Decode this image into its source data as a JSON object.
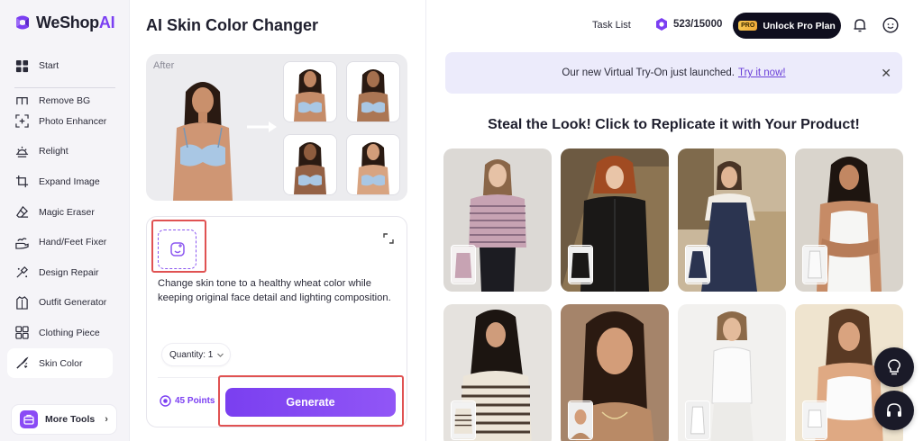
{
  "brand": {
    "name_main": "WeShop",
    "name_ai": "AI"
  },
  "sidebar": {
    "items": [
      {
        "label": "Start",
        "icon": "grid-icon"
      },
      {
        "label": "Remove BG",
        "icon": "scissors-icon"
      },
      {
        "label": "Photo Enhancer",
        "icon": "enhance-icon"
      },
      {
        "label": "Relight",
        "icon": "sun-icon"
      },
      {
        "label": "Expand Image",
        "icon": "crop-icon"
      },
      {
        "label": "Magic Eraser",
        "icon": "eraser-icon"
      },
      {
        "label": "Hand/Feet Fixer",
        "icon": "hand-icon"
      },
      {
        "label": "Design Repair",
        "icon": "repair-icon"
      },
      {
        "label": "Outfit Generator",
        "icon": "outfit-icon"
      },
      {
        "label": "Clothing Piece",
        "icon": "clothing-icon"
      },
      {
        "label": "Skin Color",
        "icon": "skin-icon"
      }
    ],
    "active": "Skin Color",
    "more_tools": "More Tools"
  },
  "tool": {
    "title": "AI Skin Color Changer",
    "preview_label": "After",
    "prompt": "Change skin tone to a healthy wheat color while keeping original face detail and lighting composition.",
    "quantity_label": "Quantity: 1",
    "points": "45 Points",
    "generate": "Generate"
  },
  "topbar": {
    "task_list": "Task List",
    "credits": "523/15000",
    "unlock": "Unlock Pro Plan",
    "pro_tag": "PRO"
  },
  "banner": {
    "text": "Our new Virtual Try-On just launched.",
    "link": "Try it now!"
  },
  "gallery": {
    "title": "Steal the Look! Click to Replicate it with Your Product!"
  },
  "colors": {
    "accent": "#7b3ff2",
    "highlight_frame": "#e05252",
    "dark": "#0f0e1e"
  }
}
